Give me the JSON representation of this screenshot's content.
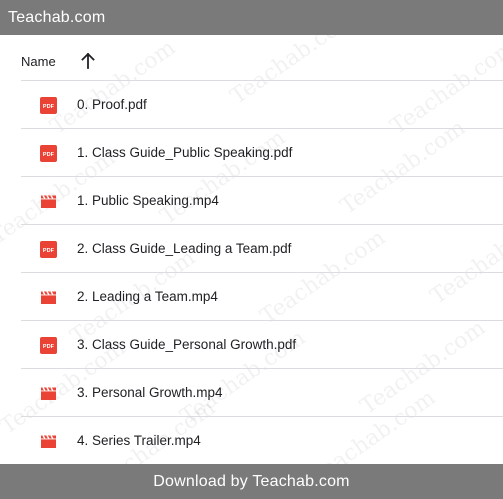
{
  "topbar": {
    "title": "Teachab.com"
  },
  "header": {
    "name_label": "Name"
  },
  "files": [
    {
      "name": "0. Proof.pdf",
      "icon": "pdf-icon"
    },
    {
      "name": "1. Class Guide_Public Speaking.pdf",
      "icon": "pdf-icon"
    },
    {
      "name": "1. Public Speaking.mp4",
      "icon": "video-icon"
    },
    {
      "name": "2. Class Guide_Leading a Team.pdf",
      "icon": "pdf-icon"
    },
    {
      "name": "2. Leading a Team.mp4",
      "icon": "video-icon"
    },
    {
      "name": "3. Class Guide_Personal Growth.pdf",
      "icon": "pdf-icon"
    },
    {
      "name": "3. Personal Growth.mp4",
      "icon": "video-icon"
    },
    {
      "name": "4. Series Trailer.mp4",
      "icon": "video-icon"
    }
  ],
  "watermark": {
    "text": "Teachab.com"
  },
  "bottombar": {
    "text": "Download by Teachab.com"
  },
  "colors": {
    "bar": "#7a7a7a",
    "icon_red": "#ea4335",
    "divider": "#dadce0"
  }
}
